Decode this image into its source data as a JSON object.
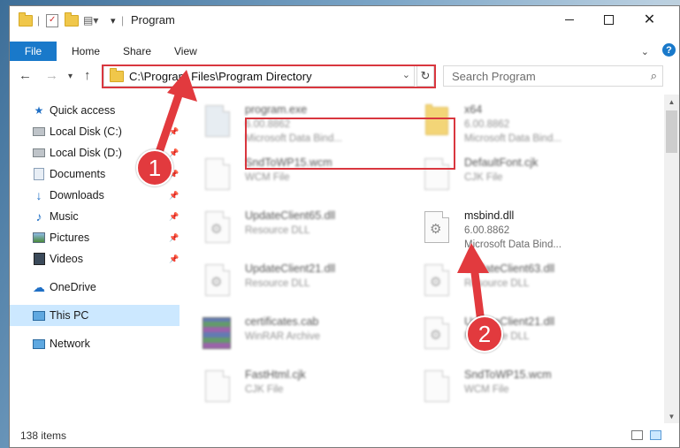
{
  "window": {
    "title": "Program",
    "minimize_icon": "minimize-icon",
    "maximize_icon": "maximize-icon",
    "close_icon": "close-icon"
  },
  "ribbon": {
    "tabs": [
      "File",
      "Home",
      "Share",
      "View"
    ]
  },
  "nav": {
    "address": "C:\\Program Files\\Program Directory",
    "search_placeholder": "Search Program"
  },
  "sidebar": {
    "items": [
      {
        "label": "Quick access",
        "icon": "star-icon"
      },
      {
        "label": "Local Disk (C:)",
        "icon": "drive-icon",
        "pinned": true
      },
      {
        "label": "Local Disk (D:)",
        "icon": "drive-icon",
        "pinned": true
      },
      {
        "label": "Documents",
        "icon": "documents-icon",
        "pinned": true
      },
      {
        "label": "Downloads",
        "icon": "downloads-icon",
        "pinned": true
      },
      {
        "label": "Music",
        "icon": "music-icon",
        "pinned": true
      },
      {
        "label": "Pictures",
        "icon": "pictures-icon",
        "pinned": true
      },
      {
        "label": "Videos",
        "icon": "videos-icon",
        "pinned": true
      },
      {
        "label": "OneDrive",
        "icon": "onedrive-icon"
      },
      {
        "label": "This PC",
        "icon": "this-pc-icon",
        "selected": true
      },
      {
        "label": "Network",
        "icon": "network-icon"
      }
    ]
  },
  "files": [
    {
      "name": "program.exe",
      "line2": "6.00.8862",
      "line3": "Microsoft Data Bind...",
      "icon": "exe-icon"
    },
    {
      "name": "x64",
      "line2": "6.00.8862",
      "line3": "Microsoft Data Bind...",
      "icon": "folder-icon"
    },
    {
      "name": "SndToWP15.wcm",
      "line2": "WCM File",
      "line3": "",
      "icon": "file-icon"
    },
    {
      "name": "DefaultFont.cjk",
      "line2": "CJK File",
      "line3": "",
      "icon": "file-icon"
    },
    {
      "name": "UpdateClient65.dll",
      "line2": "Resource DLL",
      "line3": "",
      "icon": "dll-icon"
    },
    {
      "name": "msbind.dll",
      "line2": "6.00.8862",
      "line3": "Microsoft Data Bind...",
      "icon": "dll-icon"
    },
    {
      "name": "UpdateClient21.dll",
      "line2": "Resource DLL",
      "line3": "",
      "icon": "dll-icon"
    },
    {
      "name": "UpdateClient63.dll",
      "line2": "Resource DLL",
      "line3": "",
      "icon": "dll-icon"
    },
    {
      "name": "certificates.cab",
      "line2": "WinRAR Archive",
      "line3": "",
      "icon": "archive-icon"
    },
    {
      "name": "UpdateClient21.dll",
      "line2": "Resource DLL",
      "line3": "",
      "icon": "dll-icon"
    },
    {
      "name": "FastHtml.cjk",
      "line2": "CJK File",
      "line3": "",
      "icon": "file-icon"
    },
    {
      "name": "SndToWP15.wcm",
      "line2": "WCM File",
      "line3": "",
      "icon": "file-icon"
    }
  ],
  "status": {
    "count": "138 items"
  },
  "callouts": [
    "1",
    "2"
  ],
  "colors": {
    "accent": "#1979ca",
    "highlight": "#d9373f",
    "selection": "#cce8ff"
  }
}
